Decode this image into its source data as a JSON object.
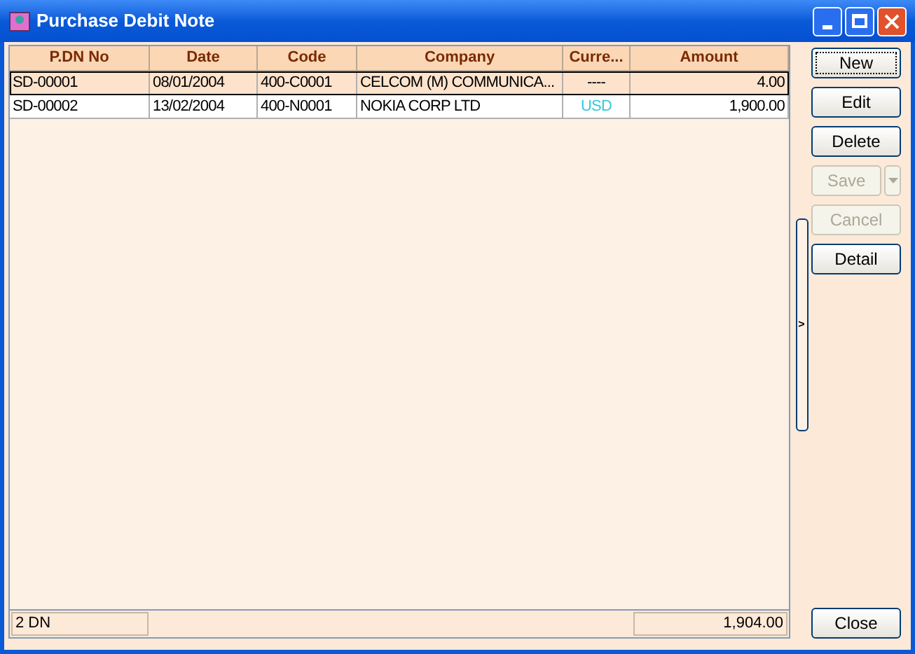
{
  "window": {
    "title": "Purchase Debit Note"
  },
  "table": {
    "columns": [
      "P.DN No",
      "Date",
      "Code",
      "Company",
      "Curre...",
      "Amount"
    ],
    "rows": [
      {
        "selected": true,
        "cells": [
          "SD-00001",
          "08/01/2004",
          "400-C0001",
          "CELCOM (M) COMMUNICA..."
        ],
        "currency": {
          "text": "----",
          "color": "#000000"
        },
        "amount": "4.00"
      },
      {
        "selected": false,
        "cells": [
          "SD-00002",
          "13/02/2004",
          "400-N0001",
          "NOKIA CORP LTD"
        ],
        "currency": {
          "text": "USD",
          "color": "#33c9d9"
        },
        "amount": "1,900.00"
      }
    ]
  },
  "buttons": [
    {
      "label": "New",
      "kind": "plain",
      "disabled": false,
      "focused": true
    },
    {
      "label": "Edit",
      "kind": "plain",
      "disabled": false,
      "focused": false
    },
    {
      "label": "Delete",
      "kind": "plain",
      "disabled": false,
      "focused": false
    },
    {
      "label": "Save",
      "kind": "split",
      "disabled": true,
      "focused": false
    },
    {
      "label": "Cancel",
      "kind": "plain",
      "disabled": true,
      "focused": false
    },
    {
      "label": "Detail",
      "kind": "plain",
      "disabled": false,
      "focused": false
    }
  ],
  "splitter": {
    "glyph": ">"
  },
  "status_bar": {
    "count": "2 DN",
    "total": "1,904.00"
  },
  "close_button": {
    "label": "Close"
  }
}
